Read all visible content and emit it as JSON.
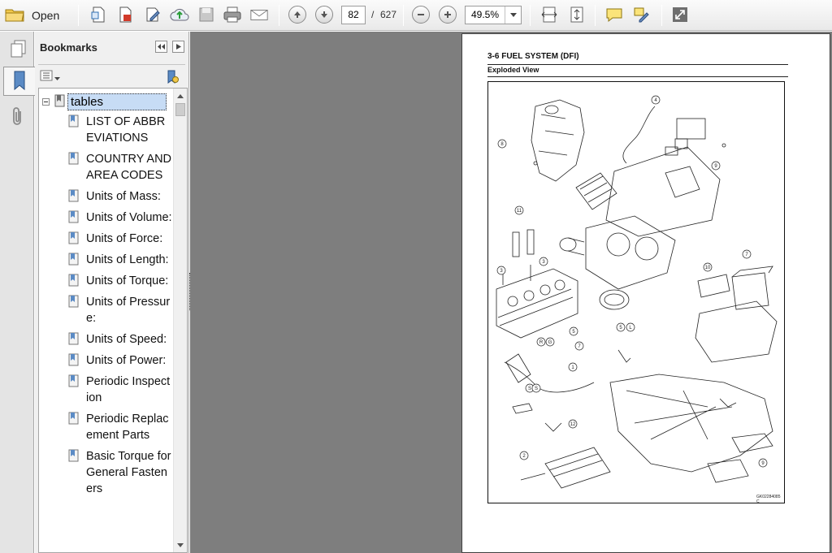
{
  "toolbar": {
    "open_label": "Open",
    "page_current": "82",
    "page_separator": "/",
    "page_total": "627",
    "zoom": "49.5%"
  },
  "panel": {
    "title": "Bookmarks",
    "tree_root": "tables",
    "bookmarks": [
      {
        "label": "LIST OF ABBREVIATIONS"
      },
      {
        "label": "COUNTRY AND AREA CODES"
      },
      {
        "label": "Units of Mass:"
      },
      {
        "label": "Units of Volume:"
      },
      {
        "label": "Units of Force:"
      },
      {
        "label": "Units of Length:"
      },
      {
        "label": "Units of Torque:"
      },
      {
        "label": "Units of Pressure:"
      },
      {
        "label": "Units of Speed:"
      },
      {
        "label": "Units of Power:"
      },
      {
        "label": "Periodic Inspection"
      },
      {
        "label": "Periodic Replacement Parts"
      },
      {
        "label": "Basic Torque for General Fasteners"
      }
    ]
  },
  "document": {
    "header": "3-6 FUEL SYSTEM (DFI)",
    "subheader": "Exploded View",
    "figure_code": "GK02284085 C",
    "callouts": [
      "1",
      "2",
      "3",
      "3",
      "4",
      "5",
      "6",
      "7",
      "8",
      "9",
      "10",
      "11",
      "12",
      "R",
      "G",
      "L",
      "5",
      "S",
      "S"
    ]
  },
  "colors": {
    "doc_background": "#7e7e7e",
    "panel_background": "#f0f0f0",
    "selection": "#c7dcf5"
  }
}
